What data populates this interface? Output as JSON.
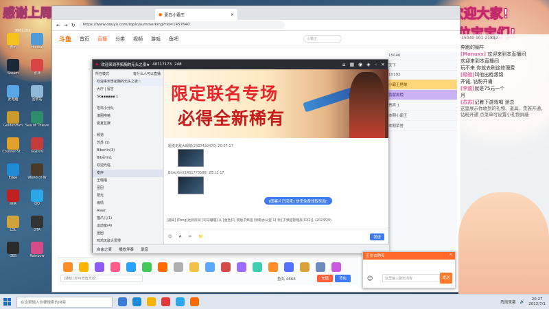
{
  "overlay": {
    "left_caption": "感谢上周摩托饲养员：苏脆",
    "right_line1": "李逵加油!欢迎大家!",
    "right_line2": "欢迎各位宝宝们!"
  },
  "desktop": {
    "counter": "9951153",
    "icons": [
      {
        "label": "腾讯",
        "color": "#f4c21c"
      },
      {
        "label": "Honkai",
        "color": "#4f9bd9"
      },
      {
        "label": "Steam",
        "color": "#1b2838"
      },
      {
        "label": "雷神",
        "color": "#d94545"
      },
      {
        "label": "此电脑",
        "color": "#58a6e6"
      },
      {
        "label": "回收站",
        "color": "#8fb8d8"
      },
      {
        "label": "GoldenHim",
        "color": "#c99a2c"
      },
      {
        "label": "Sea of Thieves",
        "color": "#2f8c6a"
      },
      {
        "label": "Counter-St...",
        "color": "#e2a12a"
      },
      {
        "label": "GGDTV",
        "color": "#c43b3b"
      },
      {
        "label": "Edge",
        "color": "#1f8bd6"
      },
      {
        "label": "World of W",
        "color": "#4a3a2a"
      },
      {
        "label": "网易",
        "color": "#c02020"
      },
      {
        "label": "QQ",
        "color": "#2aa7e8"
      },
      {
        "label": "LOL",
        "color": "#d0a23a"
      },
      {
        "label": "GTA",
        "color": "#333333"
      },
      {
        "label": "OBS",
        "color": "#2b2b2b"
      },
      {
        "label": "Rainbow",
        "color": "#d64a8a"
      }
    ]
  },
  "browser": {
    "tab_title": "夏日小霸王",
    "url": "https://www.douyu.com/topic/summerking?rid=1457640",
    "site_logo": "斗鱼",
    "nav": [
      "首页",
      "直播",
      "分类",
      "视频",
      "游戏",
      "鱼吧"
    ],
    "search_placeholder": "小霸王",
    "topic_panel": [
      "15040",
      "天下",
      "10192",
      "小霸王榜单",
      "贡献周榜",
      "贵宾 1",
      "本期小霸王",
      "本期荣誉"
    ]
  },
  "app": {
    "title": "欢迎来到李拓胸的无头之夜★",
    "room_id": "40717173",
    "online": "248",
    "left_header": "所在模式",
    "left_header_right": "有什么人可以直播",
    "welcome_line": "欢迎来到李拓胸的无头之夜☆",
    "channels": [
      "大厅 | 留言",
      "Sk▪▪▪▪▪▪ 1",
      "",
      "吃鸡小分队",
      "滚圈唠嗑",
      "夏夏互娱",
      "",
      "频道",
      "苏苏 (1)",
      "Biberlin(3)",
      "Biberlin1",
      "欢迎光临",
      "麦序",
      "王喵喵",
      "团团",
      "阳光",
      "雨情",
      "Alaar",
      "猫爪儿(1)",
      "运动室(4)",
      "团团",
      "鸡鸡无敌大爱慢",
      "公会追讨室"
    ],
    "banner_line1": "限定联名专场",
    "banner_line2": "必得全新稀有",
    "msg1_user": "超级无敌大眼睛(2307420470)  20:07:17",
    "msg2_user": "BiberGirl(2401773586)  20:11:17",
    "bubble": "[图鉴片已回来] 快来免费领取奖励!",
    "sys_msg": "[通知] [Peng]达到房间 [司马喵喵] 从 [金色]礼 奖励子频道 [领取办公室 1] 领 [子频道管理员(CA1)], (2024/29)",
    "tools": [
      "☺",
      "A",
      "✂",
      "📁"
    ],
    "send": "发送",
    "bottom_items": [
      "自由之麦",
      "播放伴奏",
      "录音"
    ]
  },
  "gift_bar": {
    "gifts": [
      "#ff8d2a",
      "#ffb400",
      "#8c5cf2",
      "#ff5c8a",
      "#2aa0ff",
      "#47c85a",
      "#ff6a00",
      "#b0b0b0",
      "#f2c14a",
      "#5aa8ff",
      "#d44a4a",
      "#9c6cff",
      "#3ccfb0",
      "#ff8d2a",
      "#5570ff",
      "#d9a23a",
      "#6b8bbf",
      "#c95ae0"
    ],
    "input_placeholder": "[通知] 你可增值大发!",
    "coins": "鱼丸 4868",
    "btn1": "充值",
    "btn2": "背包"
  },
  "popup": {
    "title": "正在去购买",
    "input_placeholder": "这里输入聊天内容",
    "send": "发送"
  },
  "obs": {
    "top": "15040  101  21892",
    "lines": [
      {
        "user": "",
        "text": "奔跑的蜗牛"
      },
      {
        "user": "[Manuxx]",
        "text": " 欢迎来到本直播间"
      },
      {
        "user": "",
        "text": "欢迎来到本直播间"
      },
      {
        "user": "",
        "text": "玩不来 你就去刷这修理费"
      },
      {
        "user": "[经验]",
        "text": "叫他出枪叛锦"
      },
      {
        "user": "",
        "text": "开诚, 钻粉开诵"
      },
      {
        "user": "[李逵]",
        "text": "就是75元一个"
      },
      {
        "user": "",
        "text": "月"
      },
      {
        "user": "[苏苏]",
        "text": "记着下游戏喝 迷总"
      }
    ],
    "notice": "这里展示你收到的礼物、道具、贵族开通、钻粉开通 点菜单可设置小礼物屏蔽"
  },
  "taskbar": {
    "search": "在这里输入你要搜索的内容",
    "weather": "阵雨来袭",
    "time": "20:27",
    "date": "2022/7/1"
  }
}
